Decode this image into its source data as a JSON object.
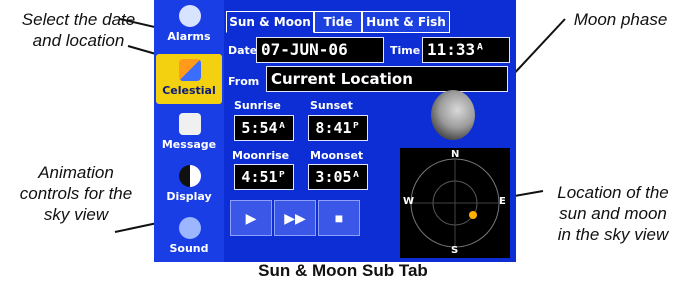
{
  "callouts": {
    "select": "Select the date\nand location",
    "moon": "Moon phase",
    "animation": "Animation\ncontrols for the\nsky view",
    "sky": "Location of the\nsun and moon\nin the sky view"
  },
  "caption": "Sun & Moon Sub Tab",
  "sidebar": {
    "items": [
      {
        "label": "Alarms",
        "icon": "alarm-clock-icon"
      },
      {
        "label": "Celestial",
        "icon": "sun-moon-icon",
        "active": true
      },
      {
        "label": "Message",
        "icon": "message-icon"
      },
      {
        "label": "Display",
        "icon": "display-icon"
      },
      {
        "label": "Sound",
        "icon": "sound-icon"
      }
    ]
  },
  "tabs": [
    "Sun & Moon",
    "Tide",
    "Hunt & Fish"
  ],
  "form": {
    "date_label": "Date",
    "date_value": "07-JUN-06",
    "time_label": "Time",
    "time_value": "11:33ᴬ",
    "from_label": "From",
    "from_value": "Current Location"
  },
  "times": {
    "sunrise_label": "Sunrise",
    "sunrise": "5:54ᴬ",
    "sunset_label": "Sunset",
    "sunset": "8:41ᴾ",
    "moonrise_label": "Moonrise",
    "moonrise": "4:51ᴾ",
    "moonset_label": "Moonset",
    "moonset": "3:05ᴬ"
  },
  "sky": {
    "n": "N",
    "s": "S",
    "w": "W",
    "e": "E"
  },
  "controls": [
    "▶",
    "▶▶",
    "■"
  ],
  "colors": {
    "screen": "#0c2ed4",
    "active": "#f3d010"
  }
}
